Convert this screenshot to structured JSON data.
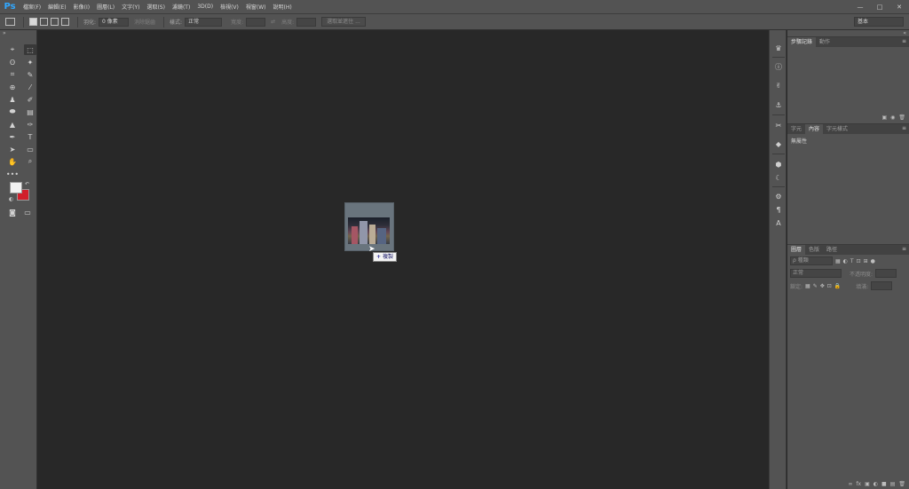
{
  "app": {
    "logo": "Ps"
  },
  "menu": [
    "檔案(F)",
    "編輯(E)",
    "影像(I)",
    "圖層(L)",
    "文字(Y)",
    "選取(S)",
    "濾鏡(T)",
    "3D(D)",
    "檢視(V)",
    "視窗(W)",
    "說明(H)"
  ],
  "window_controls": [
    "—",
    "□",
    "✕"
  ],
  "options": {
    "feather_label": "羽化:",
    "feather_value": "0 像素",
    "antialias_label": "消除鋸齒",
    "style_label": "樣式:",
    "style_value": "正常",
    "width_label": "寬度:",
    "height_label": "高度:",
    "select_mask_btn": "選取並遮住 ...",
    "workspace": "基本"
  },
  "toolbar": {
    "collapse": "»",
    "tools": [
      "⌖",
      "⬚",
      "ʘ",
      "✦",
      "⌗",
      "✎",
      "⊕",
      "⁄",
      "♟",
      "✐",
      "⬬",
      "▤",
      "▲",
      "✑",
      "✒",
      "T",
      "➤",
      "▭",
      "✋",
      "⌕",
      "•••",
      ""
    ],
    "swap": "↶",
    "reset": "◐",
    "quickmask": "◙",
    "screenmode": "▭"
  },
  "canvas": {
    "drop_badge_plus": "+",
    "drop_badge_text": "複製",
    "cursor": "➤"
  },
  "iconstrip": [
    "♛",
    "ⓘ",
    "✌",
    "⚓",
    "✂",
    "◆",
    "⬢",
    "☾",
    "⚙",
    "¶",
    "A"
  ],
  "panels": {
    "top_collapse": "«",
    "history": {
      "tabs": [
        "步驟記錄",
        "動作"
      ],
      "menu": "≡",
      "footer": [
        "▣",
        "◉",
        "🗑"
      ]
    },
    "properties": {
      "tabs": [
        "字元",
        "內容",
        "字元樣式"
      ],
      "menu": "≡",
      "label": "無屬性"
    },
    "layers": {
      "tabs": [
        "圖層",
        "色版",
        "路徑"
      ],
      "menu": "≡",
      "kind_label": "ρ 種類",
      "filter_icons": [
        "▦",
        "◐",
        "T",
        "⊡",
        "⊞",
        "●"
      ],
      "blend_mode": "正常",
      "opacity_label": "不透明度:",
      "lock_label": "鎖定:",
      "lock_icons": [
        "▦",
        "✎",
        "✥",
        "⊡",
        "🔒"
      ],
      "fill_label": "填滿:",
      "footer": [
        "∞",
        "fx",
        "▣",
        "◐",
        "■",
        "▤",
        "🗑"
      ]
    }
  }
}
